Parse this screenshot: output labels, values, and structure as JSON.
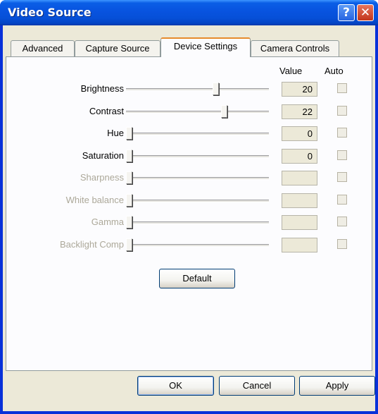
{
  "window": {
    "title": "Video Source",
    "help_glyph": "?",
    "close_glyph": "✕"
  },
  "tabs": [
    {
      "label": "Advanced",
      "active": false
    },
    {
      "label": "Capture Source",
      "active": false
    },
    {
      "label": "Device Settings",
      "active": true
    },
    {
      "label": "Camera Controls",
      "active": false
    }
  ],
  "columns": {
    "value": "Value",
    "auto": "Auto"
  },
  "settings": [
    {
      "label": "Brightness",
      "value": "20",
      "enabled": true,
      "slider_fraction": 0.635,
      "auto": false
    },
    {
      "label": "Contrast",
      "value": "22",
      "enabled": true,
      "slider_fraction": 0.7,
      "auto": false
    },
    {
      "label": "Hue",
      "value": "0",
      "enabled": true,
      "slider_fraction": 0.0,
      "auto": false
    },
    {
      "label": "Saturation",
      "value": "0",
      "enabled": true,
      "slider_fraction": 0.0,
      "auto": false
    },
    {
      "label": "Sharpness",
      "value": "",
      "enabled": false,
      "slider_fraction": 0.0,
      "auto": false
    },
    {
      "label": "White balance",
      "value": "",
      "enabled": false,
      "slider_fraction": 0.0,
      "auto": false
    },
    {
      "label": "Gamma",
      "value": "",
      "enabled": false,
      "slider_fraction": 0.0,
      "auto": false
    },
    {
      "label": "Backlight Comp",
      "value": "",
      "enabled": false,
      "slider_fraction": 0.0,
      "auto": false
    }
  ],
  "buttons": {
    "default": "Default",
    "ok": "OK",
    "cancel": "Cancel",
    "apply": "Apply"
  },
  "colors": {
    "title_bar": "#0a5ee6",
    "dialog_face": "#ece9d8",
    "active_tab_accent": "#e68b2c",
    "disabled_text": "#aca899"
  }
}
